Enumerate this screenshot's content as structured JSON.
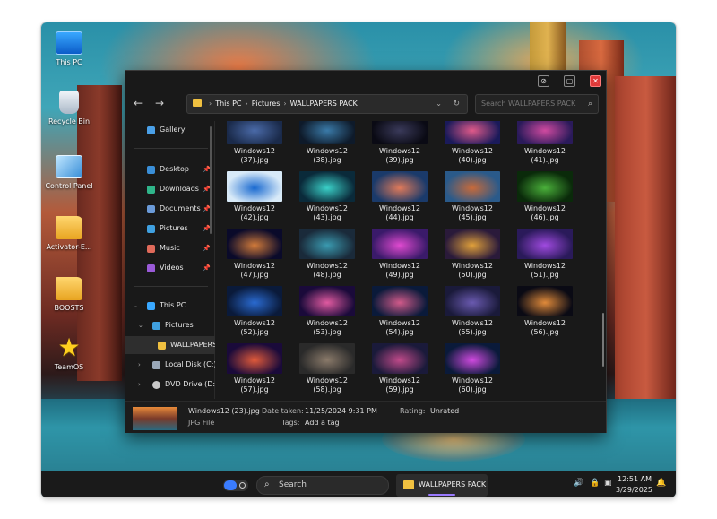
{
  "desktop": {
    "icons": [
      {
        "label": "This PC"
      },
      {
        "label": "Recycle Bin"
      },
      {
        "label": "Control Panel"
      },
      {
        "label": "Activator-E..."
      },
      {
        "label": "BOOSTS"
      },
      {
        "label": "TeamOS"
      }
    ]
  },
  "explorer": {
    "title_buttons": {
      "minimize": "⊘",
      "maximize": "▢",
      "close": "✕"
    },
    "nav": {
      "back": "←",
      "forward": "→"
    },
    "address": [
      "This PC",
      "Pictures",
      "WALLPAPERS PACK"
    ],
    "search_placeholder": "Search WALLPAPERS PACK",
    "sidebar": {
      "gallery": "Gallery",
      "quick_access": [
        {
          "label": "Desktop",
          "color": "#3a8fd8"
        },
        {
          "label": "Downloads",
          "color": "#2fb58a"
        },
        {
          "label": "Documents",
          "color": "#6a9ad8"
        },
        {
          "label": "Pictures",
          "color": "#3fa0e0"
        },
        {
          "label": "Music",
          "color": "#e06a5a"
        },
        {
          "label": "Videos",
          "color": "#9a5ad8"
        }
      ],
      "this_pc": "This PC",
      "pictures": "Pictures",
      "wallpapers": "WALLPAPERS PACK",
      "local_disk": "Local Disk (C:)",
      "dvd": "DVD Drive (D:)"
    },
    "files": [
      {
        "name1": "Windows12",
        "name2": "(37).jpg",
        "c1": "#1a2a4a",
        "c2": "#4a6aa8"
      },
      {
        "name1": "Windows12",
        "name2": "(38).jpg",
        "c1": "#0e1a2a",
        "c2": "#3a7aa8"
      },
      {
        "name1": "Windows12",
        "name2": "(39).jpg",
        "c1": "#0a0a14",
        "c2": "#3a3a5a"
      },
      {
        "name1": "Windows12",
        "name2": "(40).jpg",
        "c1": "#1a1a5a",
        "c2": "#e05a8a"
      },
      {
        "name1": "Windows12",
        "name2": "(41).jpg",
        "c1": "#2a1a5a",
        "c2": "#d04aa0"
      },
      {
        "name1": "Windows12",
        "name2": "(42).jpg",
        "c1": "#d8eaf8",
        "c2": "#1a6ad0"
      },
      {
        "name1": "Windows12",
        "name2": "(43).jpg",
        "c1": "#0a2a3a",
        "c2": "#3ad0c8"
      },
      {
        "name1": "Windows12",
        "name2": "(44).jpg",
        "c1": "#1a3a6a",
        "c2": "#e07a5a"
      },
      {
        "name1": "Windows12",
        "name2": "(45).jpg",
        "c1": "#2a5a8a",
        "c2": "#c86a3a"
      },
      {
        "name1": "Windows12",
        "name2": "(46).jpg",
        "c1": "#0a2a0a",
        "c2": "#4ab03a"
      },
      {
        "name1": "Windows12",
        "name2": "(47).jpg",
        "c1": "#0a0a2a",
        "c2": "#d07a3a"
      },
      {
        "name1": "Windows12",
        "name2": "(48).jpg",
        "c1": "#1a2a3a",
        "c2": "#3a9ab0"
      },
      {
        "name1": "Windows12",
        "name2": "(49).jpg",
        "c1": "#3a1a6a",
        "c2": "#e04ad0"
      },
      {
        "name1": "Windows12",
        "name2": "(50).jpg",
        "c1": "#2a1a3a",
        "c2": "#e0a03a"
      },
      {
        "name1": "Windows12",
        "name2": "(51).jpg",
        "c1": "#2a1a5a",
        "c2": "#a04ae0"
      },
      {
        "name1": "Windows12",
        "name2": "(52).jpg",
        "c1": "#0a1a3a",
        "c2": "#2a6ad0"
      },
      {
        "name1": "Windows12",
        "name2": "(53).jpg",
        "c1": "#1a0a3a",
        "c2": "#e05aa0"
      },
      {
        "name1": "Windows12",
        "name2": "(54).jpg",
        "c1": "#0a1a3a",
        "c2": "#d05a8a"
      },
      {
        "name1": "Windows12",
        "name2": "(55).jpg",
        "c1": "#1a1a3a",
        "c2": "#6a5ab0"
      },
      {
        "name1": "Windows12",
        "name2": "(56).jpg",
        "c1": "#0a0a14",
        "c2": "#e08a3a"
      },
      {
        "name1": "Windows12",
        "name2": "(57).jpg",
        "c1": "#1a0a3a",
        "c2": "#e05a3a"
      },
      {
        "name1": "Windows12",
        "name2": "(58).jpg",
        "c1": "#2a2a2a",
        "c2": "#8a7a6a"
      },
      {
        "name1": "Windows12",
        "name2": "(59).jpg",
        "c1": "#1a1a3a",
        "c2": "#c04a8a"
      },
      {
        "name1": "Windows12",
        "name2": "(60).jpg",
        "c1": "#0a1a3a",
        "c2": "#d04ae0"
      }
    ],
    "details": {
      "name": "Windows12 (23).jpg",
      "type": "JPG File",
      "date_label": "Date taken:",
      "date_value": "11/25/2024 9:31 PM",
      "tags_label": "Tags:",
      "tags_value": "Add a tag",
      "rating_label": "Rating:",
      "rating_value": "Unrated"
    }
  },
  "taskbar": {
    "search": "Search",
    "app": "WALLPAPERS PACK",
    "time": "12:51 AM",
    "date": "3/29/2025"
  }
}
